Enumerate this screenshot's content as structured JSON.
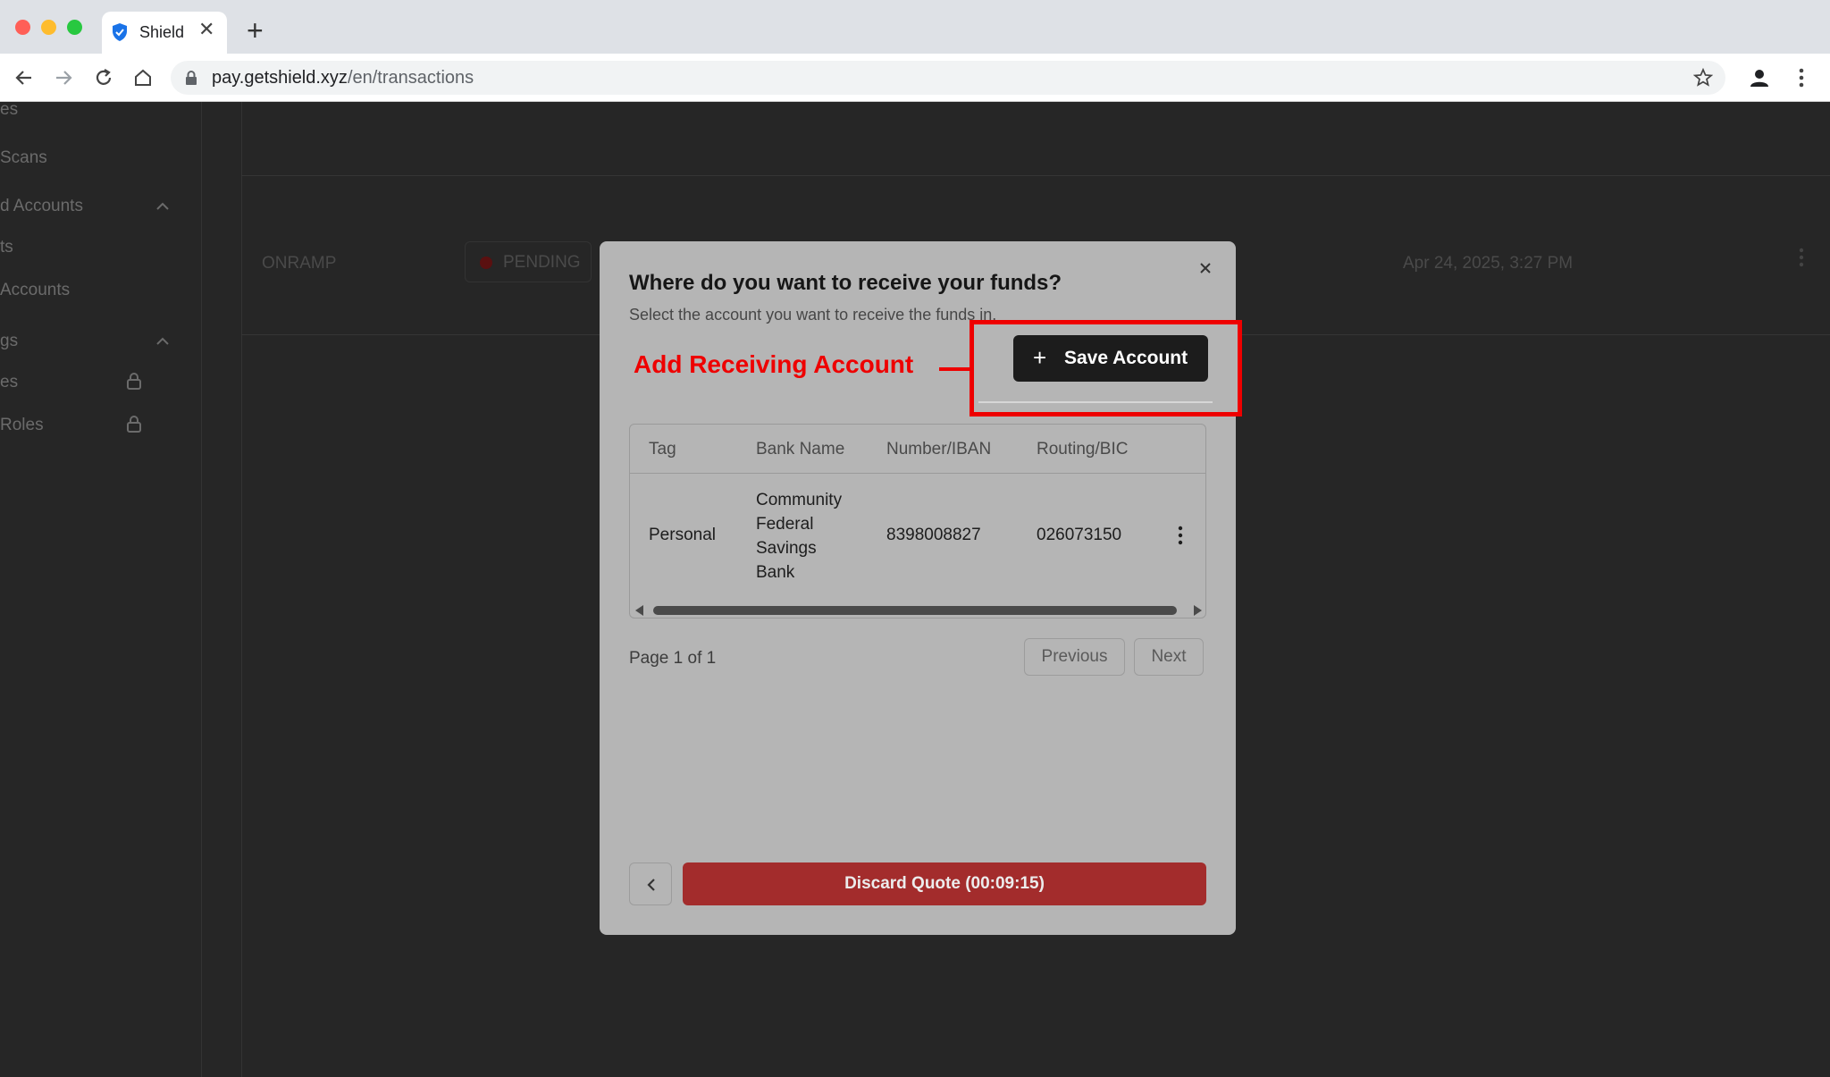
{
  "browser": {
    "tab_title": "Shield",
    "tab_close": "✕",
    "new_tab": "+",
    "url_domain": "pay.getshield.xyz",
    "url_path": "/en/transactions"
  },
  "sidebar": {
    "items": [
      {
        "label": "es"
      },
      {
        "label": "Scans"
      },
      {
        "label": "d Accounts"
      },
      {
        "label": "ts"
      },
      {
        "label": "Accounts"
      },
      {
        "label": "gs"
      },
      {
        "label": "es"
      },
      {
        "label": "Roles"
      }
    ]
  },
  "background_table": {
    "row": {
      "type": "ONRAMP",
      "status": "PENDING",
      "date": "Apr 24, 2025, 3:27 PM"
    }
  },
  "modal": {
    "close": "×",
    "title": "Where do you want to receive your funds?",
    "subtitle": "Select the account you want to receive the funds in.",
    "annotation": "Add Receiving Account",
    "save_account_plus": "+",
    "save_account_label": "Save Account",
    "table": {
      "headers": [
        "Tag",
        "Bank Name",
        "Number/IBAN",
        "Routing/BIC"
      ],
      "rows": [
        {
          "tag": "Personal",
          "bank_name": "Community Federal Savings Bank",
          "number": "8398008827",
          "routing": "026073150"
        }
      ]
    },
    "pagination": {
      "info": "Page 1 of 1",
      "previous": "Previous",
      "next": "Next"
    },
    "discard_label": "Discard Quote (00:09:15)"
  },
  "colors": {
    "annotation": "#ee0000",
    "discard": "#a32c2c",
    "save_button": "#1c1c1c"
  }
}
